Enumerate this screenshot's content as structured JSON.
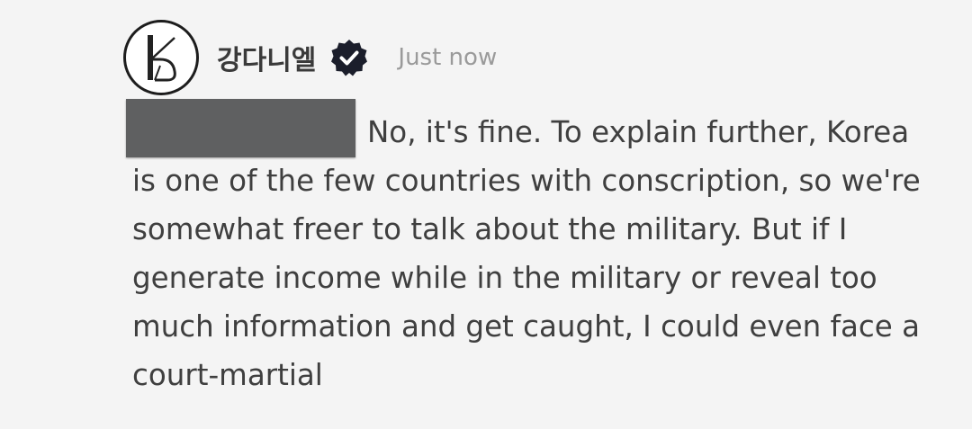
{
  "post": {
    "author": {
      "name": "강다니엘",
      "avatar_monogram": "K",
      "avatar_icon": "k-monogram-logo",
      "verified_icon": "verified-badge-icon",
      "verified_color": "#1b1e2b"
    },
    "timestamp": "Just now",
    "redaction_color": "#5f6061",
    "message_lines": [
      "No, it's fine. To explain further, Korea",
      "is one of the few countries with conscription, so we're",
      "somewhat freer to talk about the military. But if I",
      "generate income while in the military or reveal too",
      "much information and get caught, I could even face a",
      "court-martial"
    ]
  }
}
